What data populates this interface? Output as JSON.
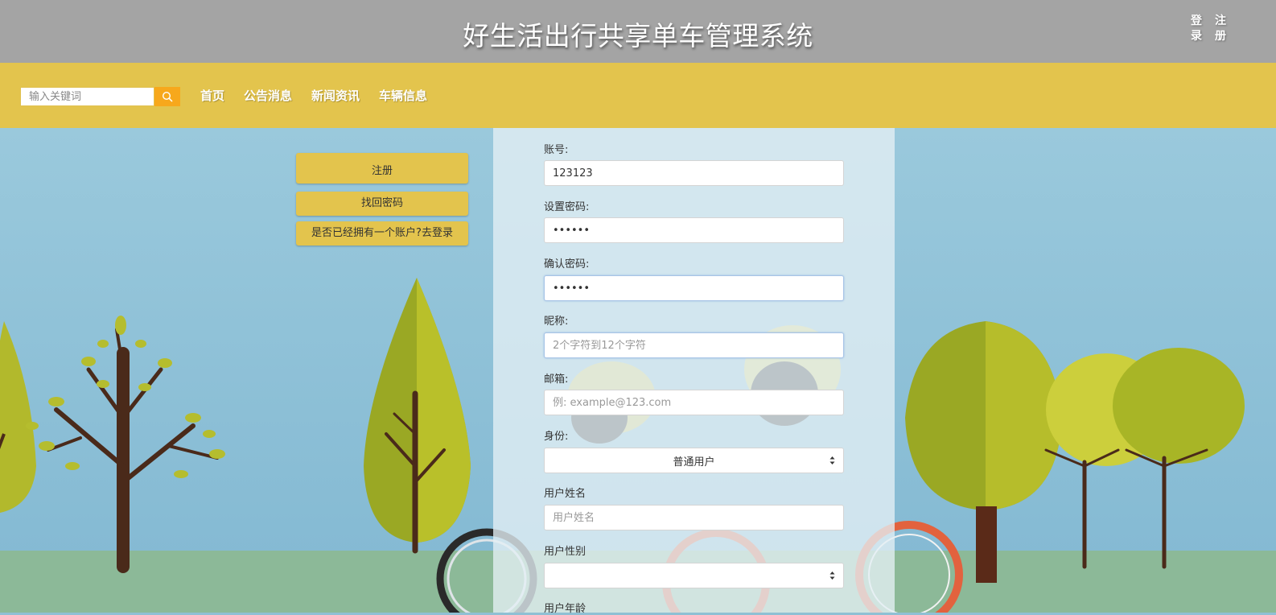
{
  "header": {
    "title": "好生活出行共享单车管理系统",
    "login_label": "登录",
    "register_label": "注册"
  },
  "nav": {
    "search_placeholder": "输入关键词",
    "links": [
      "首页",
      "公告消息",
      "新闻资讯",
      "车辆信息"
    ]
  },
  "side_buttons": {
    "register": "注册",
    "forgot_password": "找回密码",
    "have_account": "是否已经拥有一个账户?去登录"
  },
  "form": {
    "account": {
      "label": "账号:",
      "value": "123123"
    },
    "password": {
      "label": "设置密码:",
      "value": "••••••"
    },
    "confirm_password": {
      "label": "确认密码:",
      "value": "••••••"
    },
    "nickname": {
      "label": "昵称:",
      "placeholder": "2个字符到12个字符"
    },
    "email": {
      "label": "邮箱:",
      "placeholder": "例: example@123.com"
    },
    "identity": {
      "label": "身份:",
      "selected": "普通用户"
    },
    "user_name": {
      "label": "用户姓名",
      "placeholder": "用户姓名"
    },
    "user_gender": {
      "label": "用户性别",
      "selected": ""
    },
    "user_age": {
      "label": "用户年龄"
    }
  },
  "colors": {
    "header_bg": "#a4a4a4",
    "nav_bg": "#e3c44d",
    "search_button": "#f7a81c",
    "sky": "#8fc0d4",
    "grass": "#8cb998"
  }
}
